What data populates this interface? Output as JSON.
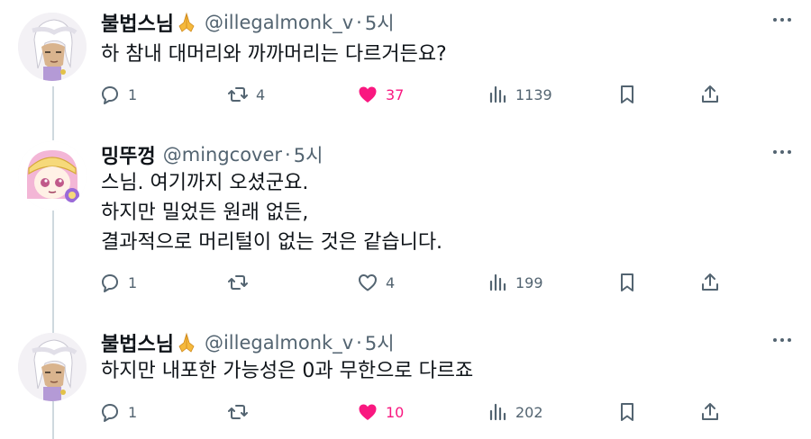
{
  "tweets": [
    {
      "name": "불법스님",
      "emoji": "🙏",
      "handle": "@illegalmonk_v",
      "sep": "·",
      "time": "5시",
      "lines": [
        "하 참내 대머리와 까까머리는 다르거든요?"
      ],
      "replies": "1",
      "retweets": "4",
      "likes": "37",
      "liked": true,
      "views": "1139"
    },
    {
      "name": "밍뚜껑",
      "handle": "@mingcover",
      "sep": "·",
      "time": "5시",
      "lines": [
        "스님. 여기까지 오셨군요.",
        "하지만 밀었든 원래 없든,",
        "결과적으로 머리털이 없는 것은 같습니다."
      ],
      "replies": "1",
      "retweets": "",
      "likes": "4",
      "liked": false,
      "views": "199"
    },
    {
      "name": "불법스님",
      "emoji": "🙏",
      "handle": "@illegalmonk_v",
      "sep": "·",
      "time": "5시",
      "lines": [
        "하지만 내포한 가능성은 0과 무한으로 다르죠"
      ],
      "replies": "1",
      "retweets": "",
      "likes": "10",
      "liked": true,
      "views": "202"
    }
  ],
  "colors": {
    "text": "#0f1419",
    "muted": "#536471",
    "like": "#f91880",
    "thread": "#cfd9de"
  }
}
